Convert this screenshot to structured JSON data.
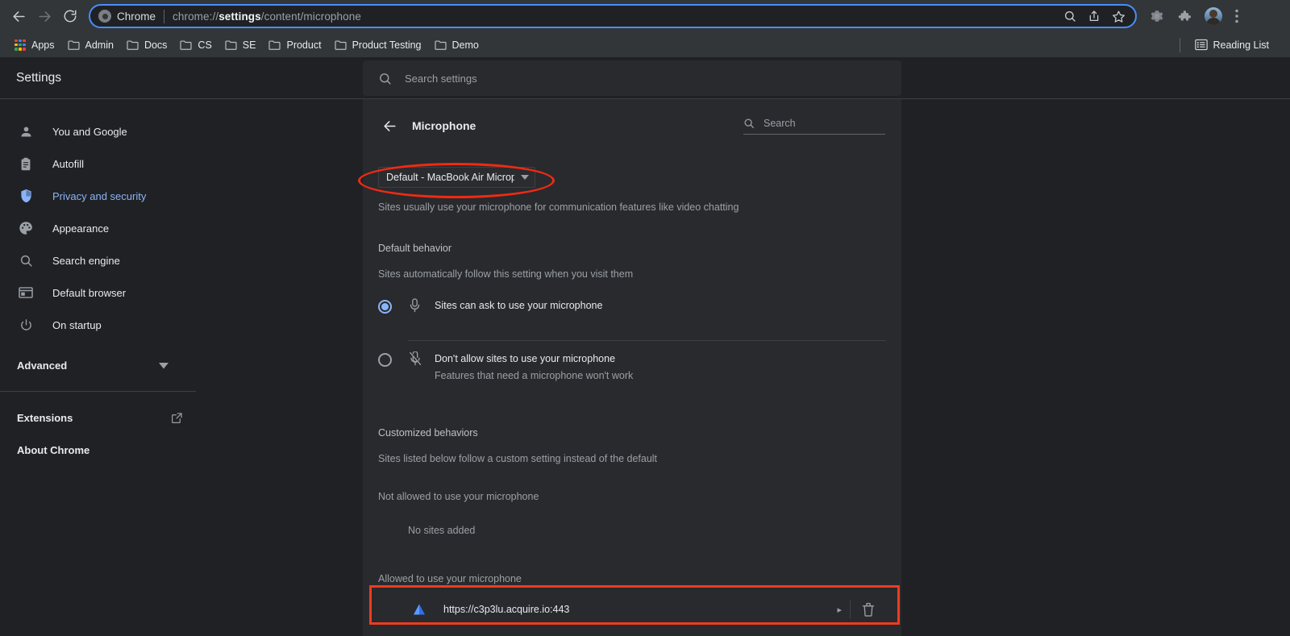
{
  "browser": {
    "nav": {
      "back_icon": "arrow-left-icon",
      "forward_icon": "arrow-right-icon",
      "reload_icon": "reload-icon"
    },
    "omnibox": {
      "chrome_badge_label": "Chrome",
      "url_prefix": "chrome://",
      "url_bold": "settings",
      "url_suffix": "/content/microphone",
      "full_url": "chrome://settings/content/microphone",
      "actions": [
        "search-icon",
        "share-icon",
        "bookmark-star-icon"
      ]
    },
    "toolbar_right": [
      "extensions-gear-icon",
      "puzzle-extensions-icon",
      "profile-avatar",
      "three-dot-menu-icon"
    ],
    "bookmarks": [
      {
        "label": "Apps",
        "icon": "apps-grid-icon"
      },
      {
        "label": "Admin",
        "icon": "folder-icon"
      },
      {
        "label": "Docs",
        "icon": "folder-icon"
      },
      {
        "label": "CS",
        "icon": "folder-icon"
      },
      {
        "label": "SE",
        "icon": "folder-icon"
      },
      {
        "label": "Product",
        "icon": "folder-icon"
      },
      {
        "label": "Product Testing",
        "icon": "folder-icon"
      },
      {
        "label": "Demo",
        "icon": "folder-icon"
      }
    ],
    "reading_list": {
      "label": "Reading List",
      "icon": "reading-list-icon"
    }
  },
  "settings": {
    "title": "Settings",
    "search": {
      "placeholder": "Search settings",
      "value": "",
      "icon": "search-icon"
    }
  },
  "sidebar": {
    "items": [
      {
        "label": "You and Google",
        "icon": "person-icon",
        "active": false
      },
      {
        "label": "Autofill",
        "icon": "clipboard-icon",
        "active": false
      },
      {
        "label": "Privacy and security",
        "icon": "shield-icon",
        "active": true
      },
      {
        "label": "Appearance",
        "icon": "palette-icon",
        "active": false
      },
      {
        "label": "Search engine",
        "icon": "search-icon",
        "active": false
      },
      {
        "label": "Default browser",
        "icon": "browser-window-icon",
        "active": false
      },
      {
        "label": "On startup",
        "icon": "power-icon",
        "active": false
      }
    ],
    "advanced": {
      "label": "Advanced",
      "icon": "chevron-down-icon"
    },
    "extensions": {
      "label": "Extensions",
      "icon": "external-link-icon"
    },
    "about": {
      "label": "About Chrome"
    }
  },
  "page": {
    "back_icon": "arrow-left-icon",
    "title": "Microphone",
    "search": {
      "placeholder": "Search",
      "value": "",
      "icon": "search-icon"
    },
    "device_select": {
      "value": "Default - MacBook Air Micropl",
      "icon": "dropdown-caret-icon"
    },
    "intro": "Sites usually use your microphone for communication features like video chatting",
    "default_behavior": {
      "heading": "Default behavior",
      "subtitle": "Sites automatically follow this setting when you visit them",
      "options": [
        {
          "label": "Sites can ask to use your microphone",
          "sublabel": "",
          "icon": "microphone-icon",
          "selected": true
        },
        {
          "label": "Don't allow sites to use your microphone",
          "sublabel": "Features that need a microphone won't work",
          "icon": "microphone-off-icon",
          "selected": false
        }
      ]
    },
    "customized_behaviors": {
      "heading": "Customized behaviors",
      "subtitle": "Sites listed below follow a custom setting instead of the default",
      "not_allowed": {
        "heading": "Not allowed to use your microphone",
        "empty": "No sites added"
      },
      "allowed": {
        "heading": "Allowed to use your microphone",
        "sites": [
          {
            "url": "https://c3p3lu.acquire.io:443",
            "favicon": "blue-triangle-favicon",
            "expand_icon": "chevron-right-icon",
            "delete_icon": "trash-icon"
          }
        ]
      }
    }
  },
  "annotations": {
    "color": "#ef2a14",
    "shapes": [
      {
        "type": "ellipse",
        "target": "device-select"
      },
      {
        "type": "rectangle",
        "target": "allowed-site-row"
      }
    ]
  }
}
